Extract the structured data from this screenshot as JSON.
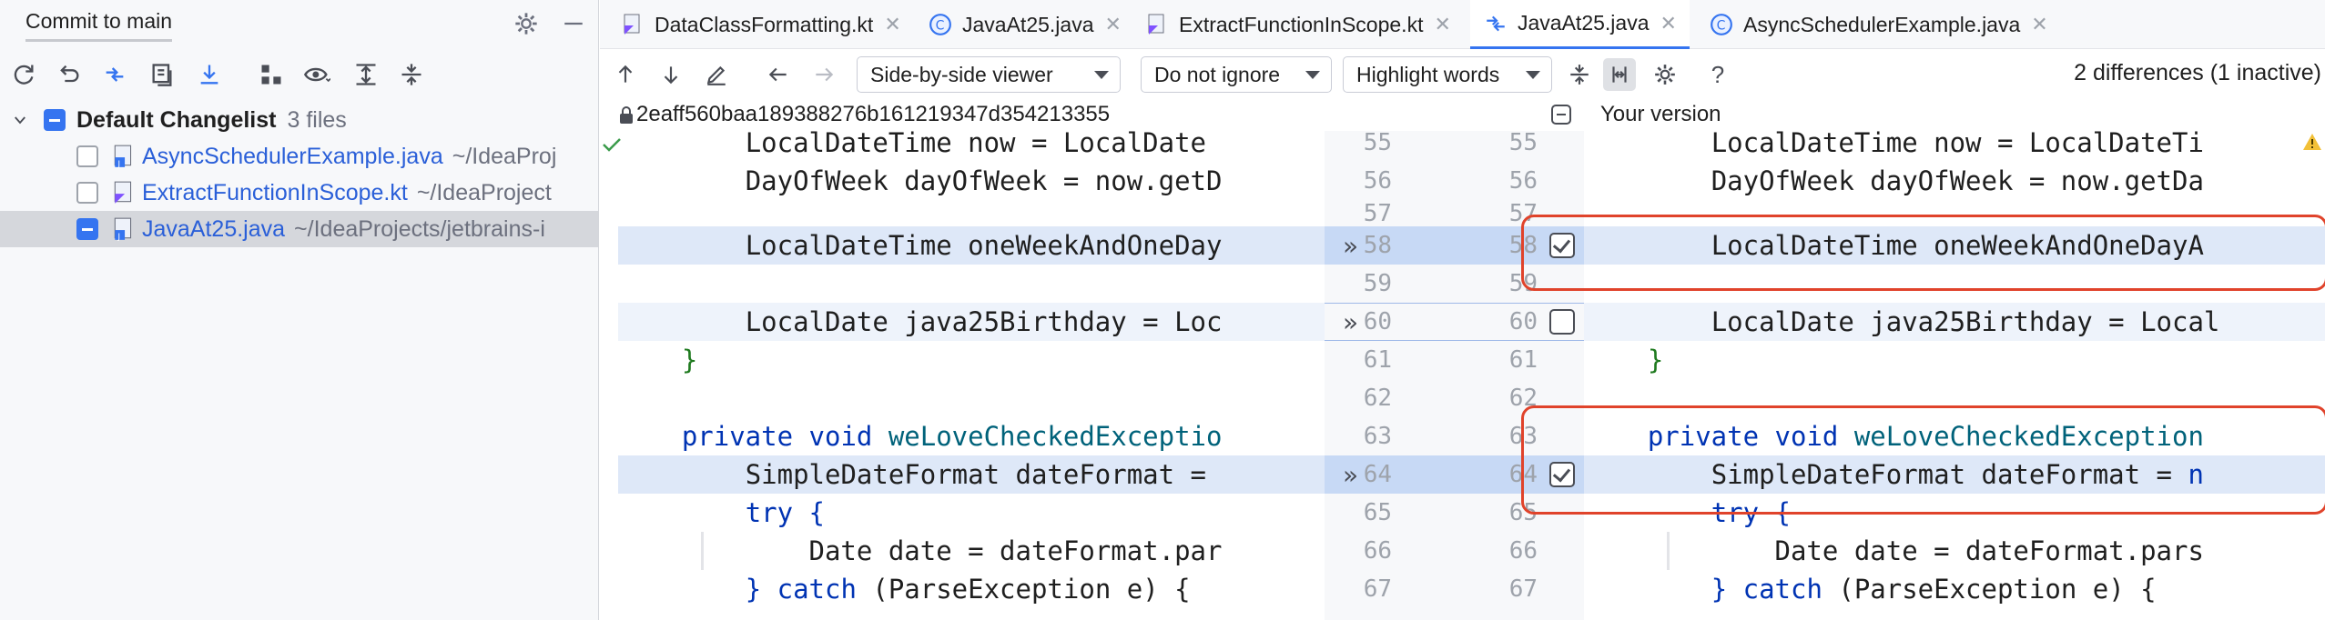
{
  "commit_panel": {
    "title": "Commit to main",
    "changelist": {
      "name": "Default Changelist",
      "count": "3 files"
    },
    "files": [
      {
        "name": "AsyncSchedulerExample.java",
        "path": "~/IdeaProj"
      },
      {
        "name": "ExtractFunctionInScope.kt",
        "path": "~/IdeaProject"
      },
      {
        "name": "JavaAt25.java",
        "path": "~/IdeaProjects/jetbrains-i"
      }
    ]
  },
  "tabs": [
    {
      "label": "DataClassFormatting.kt"
    },
    {
      "label": "JavaAt25.java"
    },
    {
      "label": "ExtractFunctionInScope.kt"
    },
    {
      "label": "JavaAt25.java"
    },
    {
      "label": "AsyncSchedulerExample.java"
    }
  ],
  "diff_toolbar": {
    "viewer": "Side-by-side viewer",
    "ignore": "Do not ignore",
    "highlight": "Highlight words",
    "help": "?",
    "differences": "2 differences (1 inactive)"
  },
  "diff_header": {
    "revision": "2eaff560baa189388276b161219347d354213355",
    "right_title": "Your version"
  },
  "line_numbers": [
    "55",
    "56",
    "57",
    "58",
    "59",
    "60",
    "61",
    "62",
    "63",
    "64",
    "65",
    "66",
    "67"
  ],
  "left_code": [
    "    LocalDateTime now = LocalDate",
    "    DayOfWeek dayOfWeek = now.getD",
    "",
    "    LocalDateTime oneWeekAndOneDay",
    "",
    "    LocalDate java25Birthday = Loc",
    "}",
    "",
    "private void weLoveCheckedExceptio",
    "    SimpleDateFormat dateFormat = ",
    "    try {",
    "        Date date = dateFormat.par",
    "    } catch (ParseException e) {"
  ],
  "right_code": [
    "    LocalDateTime now = LocalDateTi",
    "    DayOfWeek dayOfWeek = now.getDa",
    "",
    "    LocalDateTime oneWeekAndOneDayA",
    "",
    "    LocalDate java25Birthday = Local",
    "}",
    "",
    "private void weLoveCheckedException",
    "    SimpleDateFormat dateFormat = n",
    "    try {",
    "        Date date = dateFormat.pars",
    "    } catch (ParseException e) {"
  ],
  "code_tokens": {
    "l55": "LocalDateTime now = LocalDate",
    "l56": "DayOfWeek dayOfWeek = now.getD",
    "l58": "LocalDateTime oneWeekAndOneDay",
    "l60": "LocalDate java25Birthday = Loc",
    "l61": "}",
    "l63_kw": "private void",
    "l63_fn": "weLoveCheckedExceptio",
    "l64": "SimpleDateFormat dateFormat = ",
    "l65": "try {",
    "l66": "Date date = dateFormat.par",
    "l67_a": "} ",
    "l67_kw": "catch",
    "l67_b": " (ParseException e) {",
    "r55": "LocalDateTime now = LocalDateTi",
    "r56": "DayOfWeek dayOfWeek = now.getDa",
    "r58": "LocalDateTime oneWeekAndOneDayA",
    "r60": "LocalDate java25Birthday = Local",
    "r61": "}",
    "r63_kw": "private void",
    "r63_fn": "weLoveCheckedException",
    "r64": "SimpleDateFormat dateFormat = ",
    "r64_n": "n",
    "r65": "try {",
    "r66": "Date date = dateFormat.pars",
    "r67_a": "} ",
    "r67_kw": "catch",
    "r67_b": " (ParseException e) {"
  },
  "colors": {
    "accent": "#3574f0",
    "highlight": "#dee8f8",
    "annotation": "#e0432b"
  }
}
